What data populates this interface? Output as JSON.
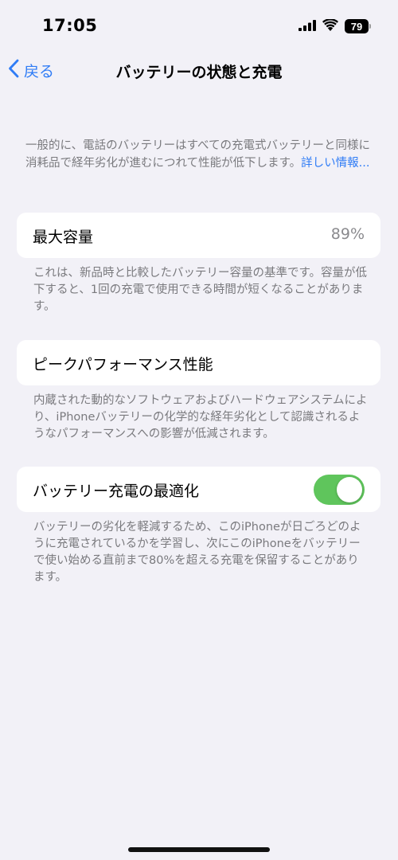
{
  "status_bar": {
    "time": "17:05",
    "battery_level": "79",
    "signal_icon": "cellular-signal-icon",
    "wifi_icon": "wifi-icon"
  },
  "nav": {
    "back_label": "戻る",
    "title": "バッテリーの状態と充電"
  },
  "intro": {
    "text": "一般的に、電話のバッテリーはすべての充電式バッテリーと同様に消耗品で経年劣化が進むにつれて性能が低下します。",
    "link": "詳しい情報..."
  },
  "max_capacity": {
    "label": "最大容量",
    "value": "89%",
    "footnote": "これは、新品時と比較したバッテリー容量の基準です。容量が低下すると、1回の充電で使用できる時間が短くなることがあります。"
  },
  "peak_performance": {
    "label": "ピークパフォーマンス性能",
    "footnote": "内蔵された動的なソフトウェアおよびハードウェアシステムにより、iPhoneバッテリーの化学的な経年劣化として認識されるようなパフォーマンスへの影響が低減されます。"
  },
  "optimized_charging": {
    "label": "バッテリー充電の最適化",
    "enabled": true,
    "footnote": "バッテリーの劣化を軽減するため、このiPhoneが日ごろどのように充電されているかを学習し、次にこのiPhoneをバッテリーで使い始める直前まで80%を超える充電を保留することがあります。"
  },
  "colors": {
    "accent": "#2f7cf6",
    "toggle_on": "#5fc55c",
    "background": "#f2f1f7",
    "secondary_text": "#7a7a7e"
  }
}
